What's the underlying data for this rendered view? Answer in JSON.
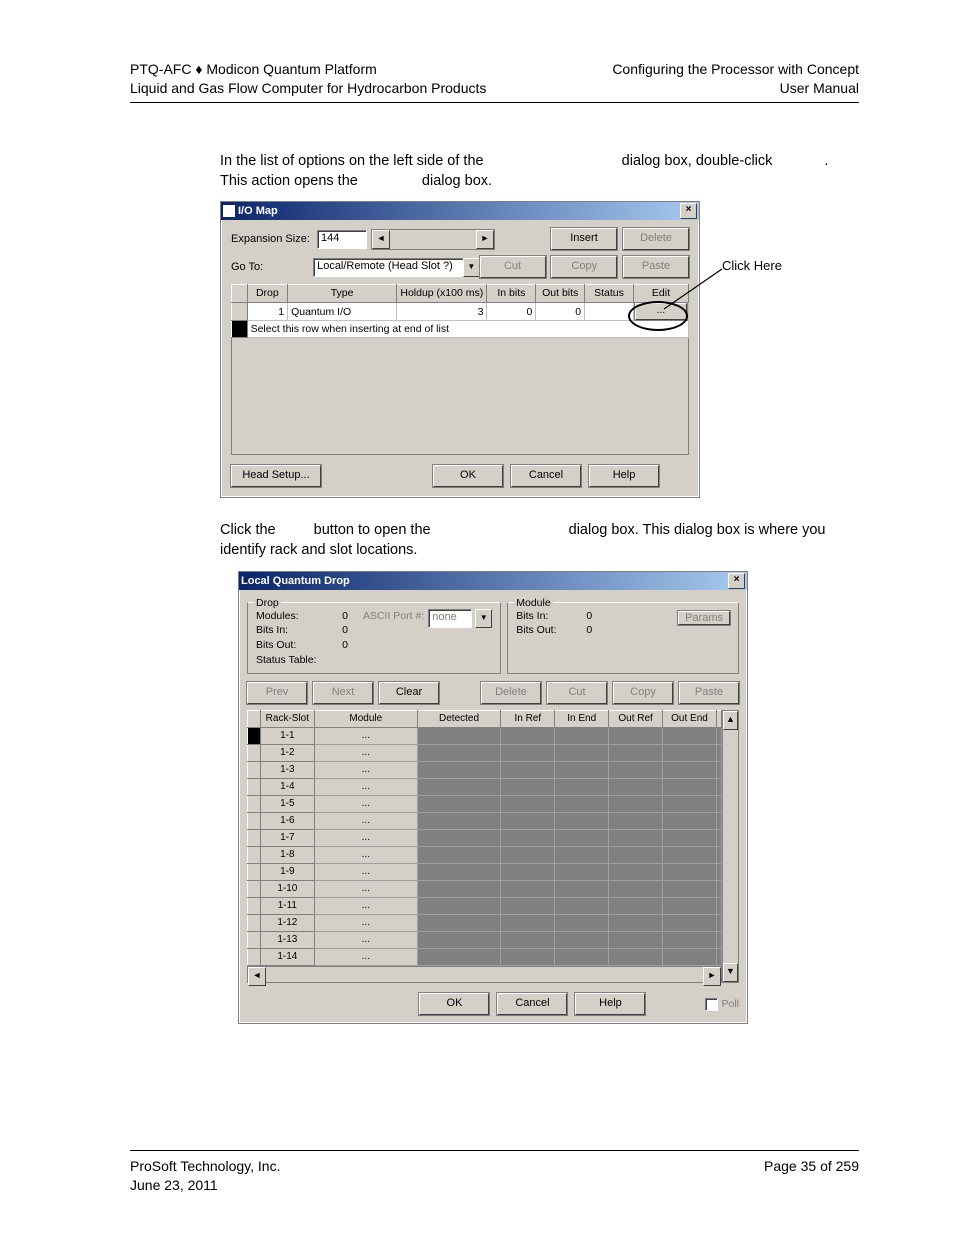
{
  "header": {
    "left1": "PTQ-AFC ♦ Modicon Quantum Platform",
    "left2": "Liquid and Gas Flow Computer for Hydrocarbon Products",
    "right1": "Configuring the Processor with Concept",
    "right2": "User Manual"
  },
  "para1_a": "In the list of options on the left side of the ",
  "para1_b": " dialog box, double-click ",
  "para1_c": ". This action opens the ",
  "para1_d": " dialog box.",
  "para2_a": "Click the ",
  "para2_b": " button to open the ",
  "para2_c": " dialog box. This dialog box is where you identify rack and slot locations.",
  "callout_click": "Click Here",
  "dlg1": {
    "title": "I/O Map",
    "expansion_label": "Expansion Size:",
    "expansion_value": "144",
    "goto_label": "Go To:",
    "goto_value": "Local/Remote (Head Slot ?)",
    "btn_insert": "Insert",
    "btn_delete": "Delete",
    "btn_cut": "Cut",
    "btn_copy": "Copy",
    "btn_paste": "Paste",
    "cols": [
      "Drop",
      "Type",
      "Holdup (x100 ms)",
      "In bits",
      "Out bits",
      "Status",
      "Edit"
    ],
    "row1": {
      "drop": "1",
      "type": "Quantum I/O",
      "holdup": "3",
      "inbits": "0",
      "outbits": "0",
      "status": "",
      "edit": "..."
    },
    "row2_text": "Select this row when inserting at end of list",
    "btn_head": "Head Setup...",
    "btn_ok": "OK",
    "btn_cancel": "Cancel",
    "btn_help": "Help"
  },
  "dlg2": {
    "title": "Local Quantum Drop",
    "drop_legend": "Drop",
    "module_legend": "Module",
    "modules_label": "Modules:",
    "modules_val": "0",
    "bitsin_label": "Bits In:",
    "bitsin_val": "0",
    "bitsout_label": "Bits Out:",
    "bitsout_val": "0",
    "status_label": "Status Table:",
    "ascii_label": "ASCII Port #:",
    "ascii_val": "none",
    "m_bitsin_label": "Bits In:",
    "m_bitsin_val": "0",
    "m_bitsout_label": "Bits Out:",
    "m_bitsout_val": "0",
    "btn_params": "Params",
    "btn_prev": "Prev",
    "btn_next": "Next",
    "btn_clear": "Clear",
    "btn_delete": "Delete",
    "btn_cut": "Cut",
    "btn_copy": "Copy",
    "btn_paste": "Paste",
    "cols": [
      "Rack-Slot",
      "Module",
      "Detected",
      "In Ref",
      "In End",
      "Out Ref",
      "Out End",
      ""
    ],
    "rows": [
      "1-1",
      "1-2",
      "1-3",
      "1-4",
      "1-5",
      "1-6",
      "1-7",
      "1-8",
      "1-9",
      "1-10",
      "1-11",
      "1-12",
      "1-13",
      "1-14"
    ],
    "module_cell": "...",
    "btn_ok": "OK",
    "btn_cancel": "Cancel",
    "btn_help": "Help",
    "poll_label": "Poll"
  },
  "footer": {
    "left1": "ProSoft Technology, Inc.",
    "left2": "June 23, 2011",
    "right": "Page 35 of 259"
  }
}
